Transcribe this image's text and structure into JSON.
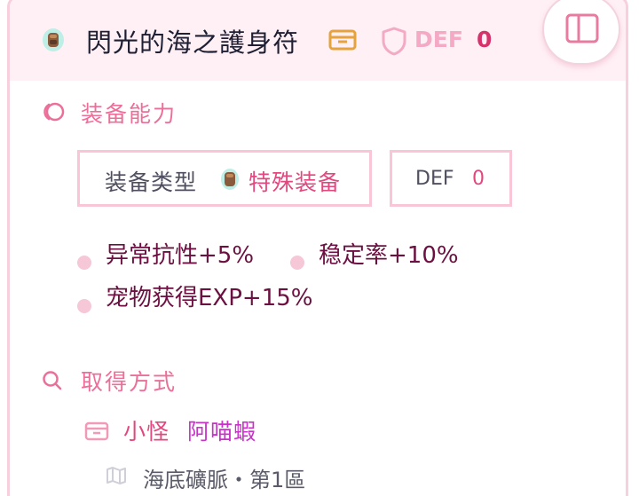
{
  "header": {
    "title": "閃光的海之護身符",
    "def_label": "DEF",
    "def_value": "0"
  },
  "ability_section": {
    "title": "装备能力",
    "type_label": "装备类型",
    "type_value": "特殊装备",
    "def_label": "DEF",
    "def_value": "0",
    "stats": [
      "异常抗性+5%",
      "稳定率+10%",
      "宠物获得EXP+15%"
    ]
  },
  "source_section": {
    "title": "取得方式",
    "source_type": "小怪",
    "source_name": "阿喵蝦",
    "location": "海底礦脈・第1區"
  },
  "icons": {
    "item": "amulet-icon",
    "box": "box-icon",
    "shield": "shield-icon",
    "panel": "sidebar-panel-icon",
    "ability": "swirl-icon",
    "search": "search-icon",
    "source": "box-icon",
    "map": "map-icon"
  },
  "colors": {
    "accent_pink": "#ec6f9a",
    "def_value": "#d6336c",
    "stat_text": "#6b1040",
    "monster_name": "#c832c8",
    "box_orange": "#e6a23c",
    "header_bg": "#fff0f5"
  }
}
